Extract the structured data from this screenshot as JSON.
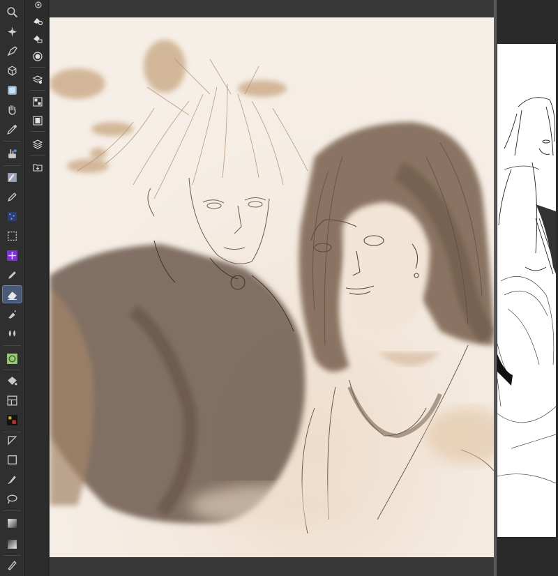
{
  "app": {
    "type": "painting-application"
  },
  "toolbar": {
    "tools": [
      {
        "icon": "zoom-icon",
        "active": false
      },
      {
        "icon": "magic-wand-icon",
        "active": false
      },
      {
        "icon": "pen-nib-icon",
        "active": false
      },
      {
        "icon": "3d-object-icon",
        "active": false
      },
      {
        "icon": "color-tile-icon",
        "active": false
      },
      {
        "icon": "hand-icon",
        "active": false
      },
      {
        "icon": "eyedropper-icon",
        "active": false
      },
      {
        "icon": "operation-icon",
        "active": false
      },
      {
        "icon": "texture-brush-icon",
        "active": false
      },
      {
        "icon": "pen-icon",
        "active": false
      },
      {
        "icon": "noise-brush-icon",
        "active": false
      },
      {
        "icon": "selection-rect-icon",
        "active": false
      },
      {
        "icon": "sparkle-brush-icon",
        "active": false
      },
      {
        "icon": "pencil-icon",
        "active": false
      },
      {
        "icon": "eraser-icon",
        "active": true
      },
      {
        "icon": "airbrush-icon",
        "active": false
      },
      {
        "icon": "blend-icon",
        "active": false
      },
      {
        "icon": "pattern-brush-icon",
        "active": false
      },
      {
        "icon": "fill-bucket-icon",
        "active": false
      },
      {
        "icon": "frame-border-icon",
        "active": false
      },
      {
        "icon": "gradient-map-icon",
        "active": false
      },
      {
        "icon": "ruler-icon",
        "active": false
      },
      {
        "icon": "rectangle-icon",
        "active": false
      },
      {
        "icon": "brush-icon",
        "active": false
      },
      {
        "icon": "lasso-icon",
        "active": false
      },
      {
        "icon": "gradient-icon",
        "active": false
      },
      {
        "icon": "gradient-2-icon",
        "active": false
      },
      {
        "icon": "correction-icon",
        "active": false
      }
    ]
  },
  "subtools": {
    "items": [
      {
        "icon": "layer-settings-icon"
      },
      {
        "icon": "eraser-settings-icon"
      },
      {
        "icon": "eraser-layer-icon"
      },
      {
        "icon": "circle-target-icon"
      },
      {
        "icon": "stack-settings-icon"
      },
      {
        "icon": "grid-view-icon"
      },
      {
        "icon": "filmstrip-icon"
      },
      {
        "icon": "layers-icon"
      },
      {
        "icon": "import-icon"
      }
    ]
  },
  "colors": {
    "canvas_bg": "#f6efe7",
    "sepia_dark": "#6d5a4c",
    "sepia_light": "#c8a583",
    "active_tool": "#4a5a78"
  }
}
